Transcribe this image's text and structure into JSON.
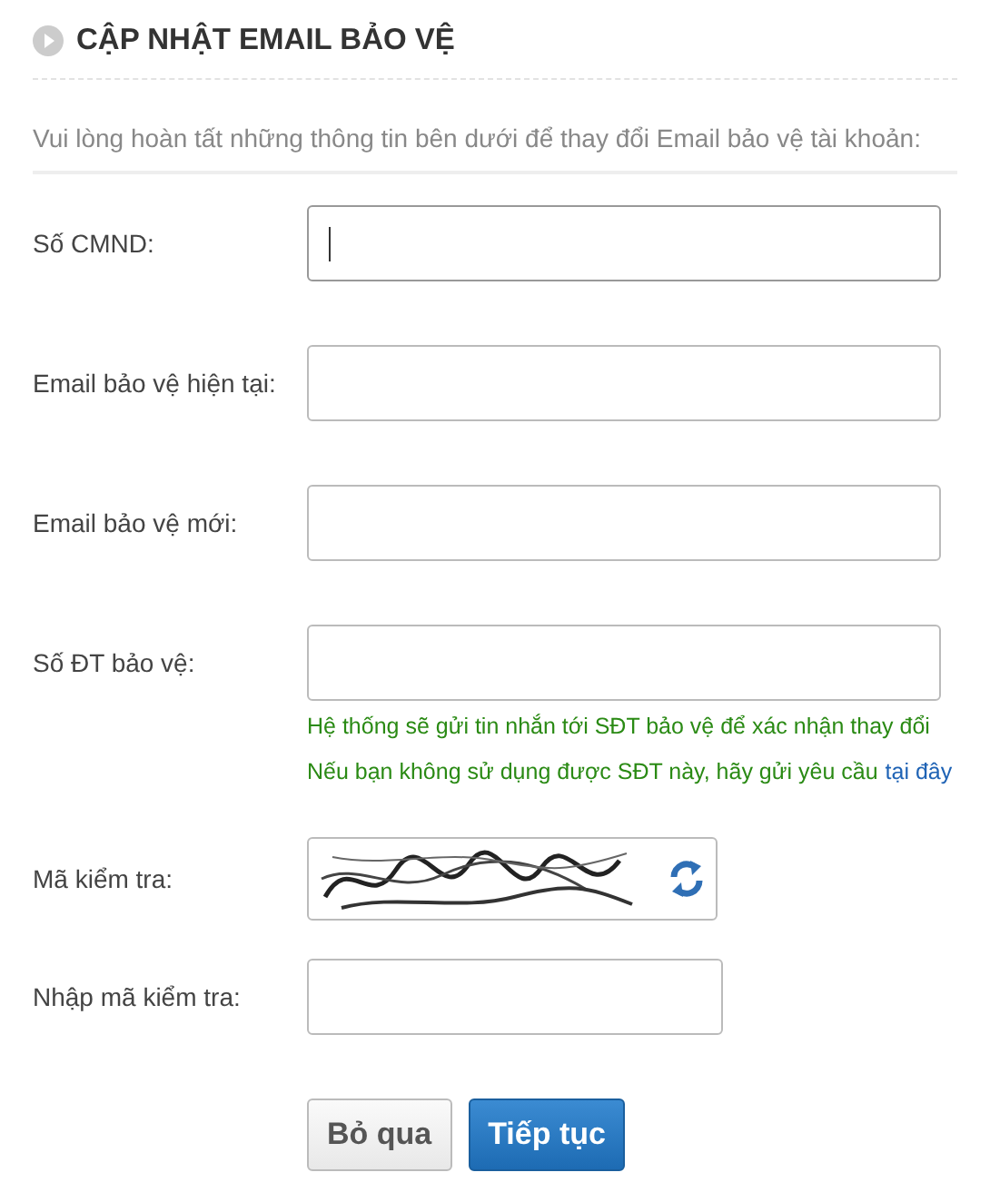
{
  "title": "CẬP NHẬT EMAIL BẢO VỆ",
  "intro": "Vui lòng hoàn tất những thông tin bên dưới để thay đổi Email bảo vệ tài khoản:",
  "fields": [
    {
      "kind": "input",
      "label": "Số CMND:",
      "focused": true
    },
    {
      "kind": "input",
      "label": "Email bảo vệ hiện tại:",
      "focused": false
    },
    {
      "kind": "input",
      "label": "Email bảo vệ mới:",
      "focused": false
    },
    {
      "kind": "input",
      "label": "Số ĐT bảo vệ:",
      "focused": false,
      "notes": [
        "Hệ thống sẽ gửi tin nhắn tới SĐT bảo vệ để xác nhận thay đổi"
      ],
      "note_link": {
        "text": "Nếu bạn không sử dụng được SĐT này, hãy gửi yêu cầu",
        "link": "tại đây"
      }
    },
    {
      "kind": "captcha",
      "label": "Mã kiểm tra:"
    },
    {
      "kind": "short_input",
      "label": "Nhập mã kiểm tra:",
      "focused": false
    }
  ],
  "buttons": [
    {
      "label": "Bỏ qua",
      "kind": "secondary"
    },
    {
      "label": "Tiếp tục",
      "kind": "primary"
    }
  ]
}
